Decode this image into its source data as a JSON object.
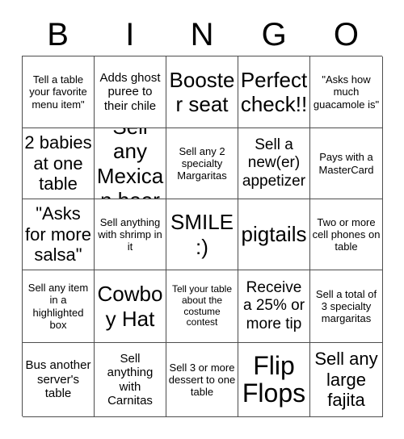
{
  "card": {
    "title": "BINGO",
    "header_letters": [
      "B",
      "I",
      "N",
      "G",
      "O"
    ],
    "grid_size": "5x5",
    "colors": {
      "border": "#4d4d4d",
      "text": "#000000",
      "background": "#ffffff"
    },
    "rows": [
      [
        {
          "text": "Tell a table your favorite menu item\"",
          "size": "sm"
        },
        {
          "text": "Adds ghost puree to their chile",
          "size": "md"
        },
        {
          "text": "Booster seat",
          "size": "xxl"
        },
        {
          "text": "Perfect check!!",
          "size": "xxl"
        },
        {
          "text": "\"Asks how much guacamole is\"",
          "size": "sm"
        }
      ],
      [
        {
          "text": "2 babies at one table",
          "size": "xl"
        },
        {
          "text": "Sell any Mexican beer",
          "size": "xxl"
        },
        {
          "text": "Sell any 2 specialty Margaritas",
          "size": "sm"
        },
        {
          "text": "Sell a new(er) appetizer",
          "size": "lg"
        },
        {
          "text": "Pays with a MasterCard",
          "size": "sm"
        }
      ],
      [
        {
          "text": "\"Asks for more salsa\"",
          "size": "xl"
        },
        {
          "text": "Sell anything with shrimp in it",
          "size": "sm"
        },
        {
          "text": "SMILE :)",
          "size": "xxl"
        },
        {
          "text": "pigtails",
          "size": "xxl"
        },
        {
          "text": "Two or more cell phones on table",
          "size": "sm"
        }
      ],
      [
        {
          "text": "Sell any item in a highlighted box",
          "size": "sm"
        },
        {
          "text": "Cowboy Hat",
          "size": "xxl"
        },
        {
          "text": "Tell your table about the costume contest",
          "size": "xs"
        },
        {
          "text": "Receive a 25% or more tip",
          "size": "lg"
        },
        {
          "text": "Sell a total of 3 specialty margaritas",
          "size": "sm"
        }
      ],
      [
        {
          "text": "Bus another server's table",
          "size": "md"
        },
        {
          "text": "Sell anything with Carnitas",
          "size": "md"
        },
        {
          "text": "Sell 3 or more dessert to one table",
          "size": "sm"
        },
        {
          "text": "Flip Flops",
          "size": "huge"
        },
        {
          "text": "Sell any large fajita",
          "size": "xl"
        }
      ]
    ]
  }
}
